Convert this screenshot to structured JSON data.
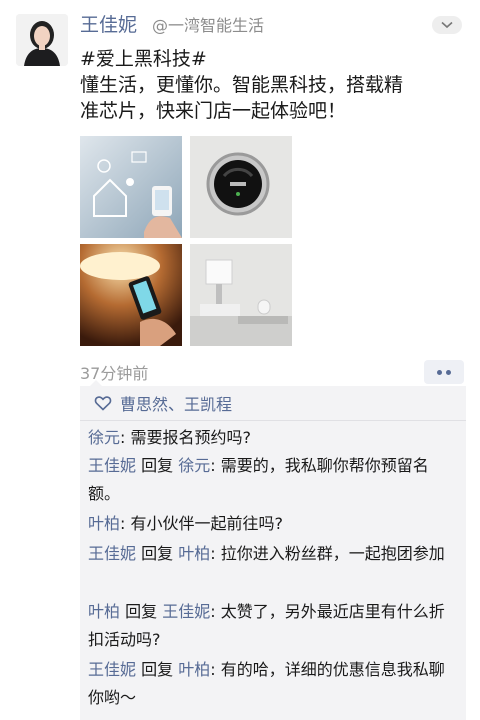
{
  "post": {
    "author": "王佳妮",
    "handle": "@一湾智能生活",
    "line1": "#爱上黑科技#",
    "line2": "懂生活，更懂你。智能黑科技，搭载精",
    "line3": "准芯片，快来门店一起体验吧！",
    "time": "37分钟前"
  },
  "likes": {
    "names": "曹思然、王凯程"
  },
  "comments": [
    {
      "user": "徐元",
      "reply_word": "",
      "to": "",
      "text": ": 需要报名预约吗?"
    },
    {
      "user": "王佳妮",
      "reply_word": "回复",
      "to": "徐元",
      "text": ": 需要的，我私聊你帮你预留名额。"
    },
    {
      "user": "叶柏",
      "reply_word": "",
      "to": "",
      "text": ": 有小伙伴一起前往吗?"
    },
    {
      "user": "王佳妮",
      "reply_word": "回复",
      "to": "叶柏",
      "text": ": 拉你进入粉丝群，一起抱团参加"
    },
    {
      "user": "叶柏",
      "reply_word": "回复",
      "to": "王佳妮",
      "text": ": 太赞了，另外最近店里有什么折扣活动吗?"
    },
    {
      "user": "王佳妮",
      "reply_word": "回复",
      "to": "叶柏",
      "text": ": 有的哈，详细的优惠信息我私聊你哟～"
    }
  ],
  "icons": {
    "menu": "chevron-down-icon",
    "more": "more-dots-icon",
    "like": "heart-icon"
  },
  "colors": {
    "link": "#576b95",
    "comment_bg": "#f3f3f5",
    "time": "#9b9b9b"
  }
}
